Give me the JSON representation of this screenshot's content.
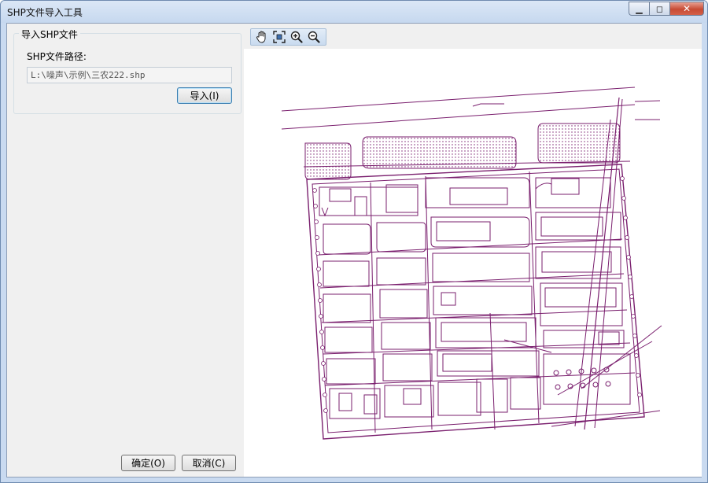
{
  "window": {
    "title": "SHP文件导入工具",
    "controls": {
      "minimize": "▁",
      "maximize": "◻",
      "close": "✕"
    }
  },
  "import_group": {
    "title": "导入SHP文件",
    "path_label": "SHP文件路径:",
    "path_value": "L:\\噪声\\示例\\三农222.shp",
    "import_button": "导入(I)"
  },
  "footer": {
    "ok_button": "确定(O)",
    "cancel_button": "取消(C)"
  },
  "toolbar": {
    "tools": [
      "pan-hand-icon",
      "full-extent-icon",
      "zoom-in-icon",
      "zoom-out-icon"
    ]
  },
  "colors": {
    "map_stroke": "#7a1f6e",
    "window_frame": "#c9daf0",
    "toolbar_accent": "#3d6fb0"
  }
}
